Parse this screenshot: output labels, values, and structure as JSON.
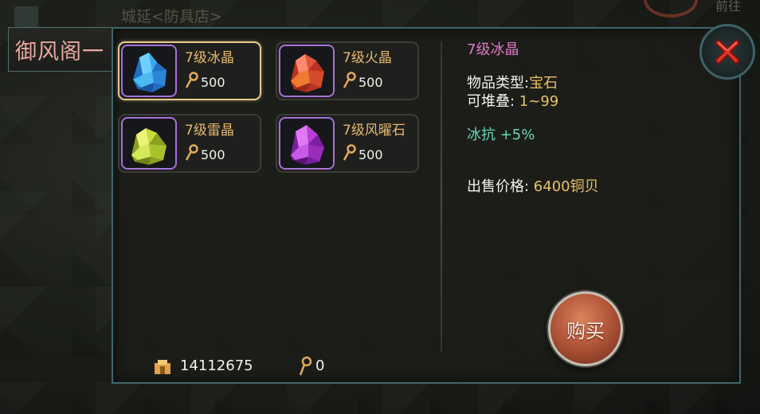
{
  "background": {
    "scene_text": "城延<防具店>",
    "corner_text": "前往"
  },
  "shop": {
    "tab_label": "御风阁一"
  },
  "items": [
    {
      "name": "7级冰晶",
      "price": "500",
      "color": "#3aa8e8",
      "selected": true
    },
    {
      "name": "7级火晶",
      "price": "500",
      "color": "#e0553c",
      "selected": false
    },
    {
      "name": "7级雷晶",
      "price": "500",
      "color": "#b8d43a",
      "selected": false
    },
    {
      "name": "7级风曜石",
      "price": "500",
      "color": "#b640d6",
      "selected": false
    }
  ],
  "detail": {
    "title": "7级冰晶",
    "type_label": "物品类型:",
    "type_value": "宝石",
    "stack_label": "可堆叠:",
    "stack_value": " 1~99",
    "attribute": "冰抗  +5%",
    "sell_label": "出售价格:",
    "sell_value": " 6400铜贝"
  },
  "buttons": {
    "buy": "购买"
  },
  "footer": {
    "copper_amount": "14112675",
    "key_amount": "0"
  },
  "colors": {
    "accent_border": "#41656a",
    "item_name": "#e6b86e",
    "title_pink": "#e07ac7"
  }
}
